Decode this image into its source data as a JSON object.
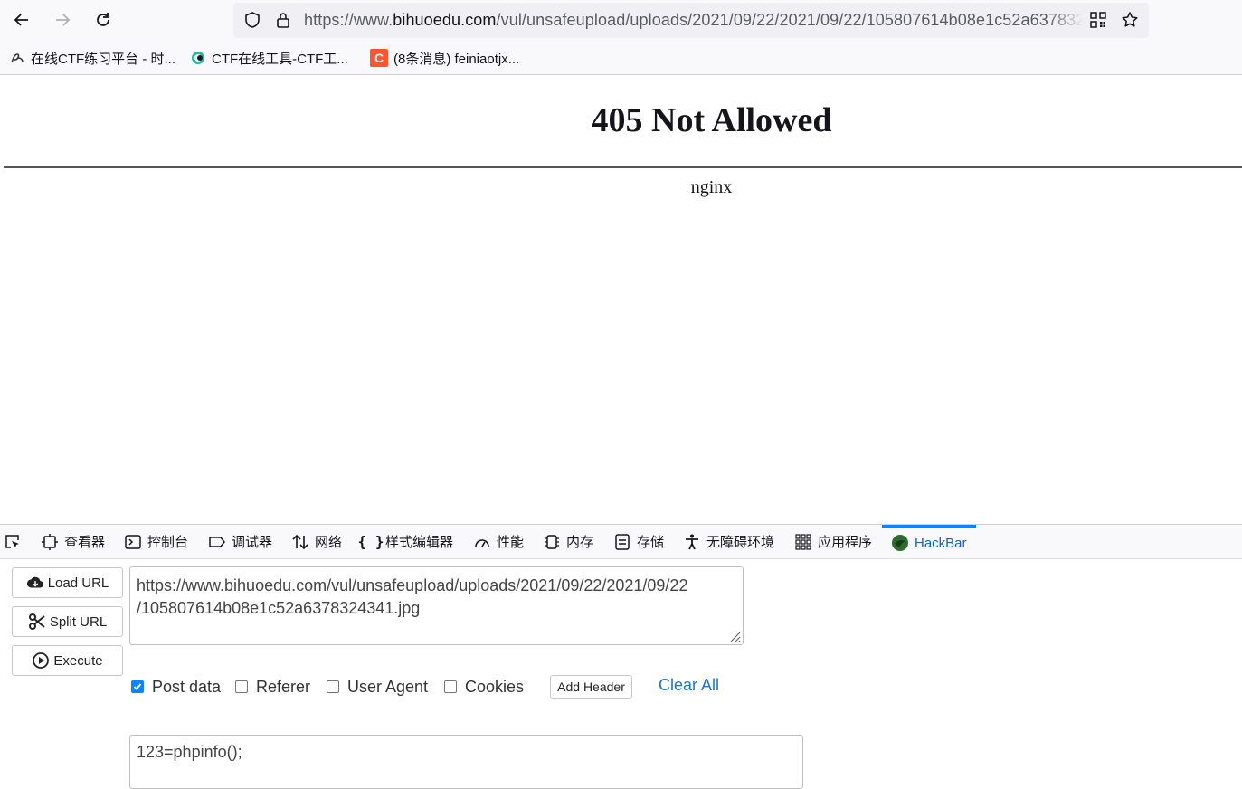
{
  "browser": {
    "url_scheme": "https://www.",
    "url_host": "bihuoedu.com",
    "url_path": "/vul/unsafeupload/uploads/2021/09/22/2021/09/22/105807614b08e1c52a6378324341.jpg",
    "icons": [
      "back-arrow-icon",
      "forward-arrow-icon",
      "reload-icon",
      "shield-icon",
      "lock-icon",
      "qr-code-icon",
      "star-icon"
    ]
  },
  "bookmarks": [
    {
      "label": "在线CTF练习平台 - 时...",
      "icon": "ctf-platform-favicon"
    },
    {
      "label": "CTF在线工具-CTF工...",
      "icon": "ctf-tools-favicon"
    },
    {
      "label": "(8条消息) feiniaotjx...",
      "icon": "csdn-favicon",
      "icon_text": "C",
      "icon_color": "#fc5531"
    }
  ],
  "page": {
    "title": "405 Not Allowed",
    "server": "nginx"
  },
  "devtools": {
    "tabs": [
      {
        "label": "查看器",
        "icon": "inspector-icon"
      },
      {
        "label": "控制台",
        "icon": "console-icon"
      },
      {
        "label": "调试器",
        "icon": "debugger-icon"
      },
      {
        "label": "网络",
        "icon": "network-icon"
      },
      {
        "label": "样式编辑器",
        "icon": "style-editor-icon"
      },
      {
        "label": "性能",
        "icon": "performance-icon"
      },
      {
        "label": "内存",
        "icon": "memory-icon"
      },
      {
        "label": "存储",
        "icon": "storage-icon"
      },
      {
        "label": "无障碍环境",
        "icon": "accessibility-icon"
      },
      {
        "label": "应用程序",
        "icon": "application-icon"
      },
      {
        "label": "HackBar",
        "icon": "hackbar-icon",
        "active": true
      }
    ],
    "accent": "#0a84ff"
  },
  "hackbar": {
    "load_url": "Load URL",
    "split_url": "Split URL",
    "execute": "Execute",
    "url_line1": "https://www.bihuoedu.com/vul/unsafeupload/uploads/2021/09/22/2021/09/22",
    "url_line2": "/105807614b08e1c52a6378324341.jpg",
    "options": [
      {
        "label": "Post data",
        "checked": true
      },
      {
        "label": "Referer",
        "checked": false
      },
      {
        "label": "User Agent",
        "checked": false
      },
      {
        "label": "Cookies",
        "checked": false
      }
    ],
    "add_header": "Add Header",
    "clear_all": "Clear All",
    "post_data": "123=phpinfo();"
  }
}
